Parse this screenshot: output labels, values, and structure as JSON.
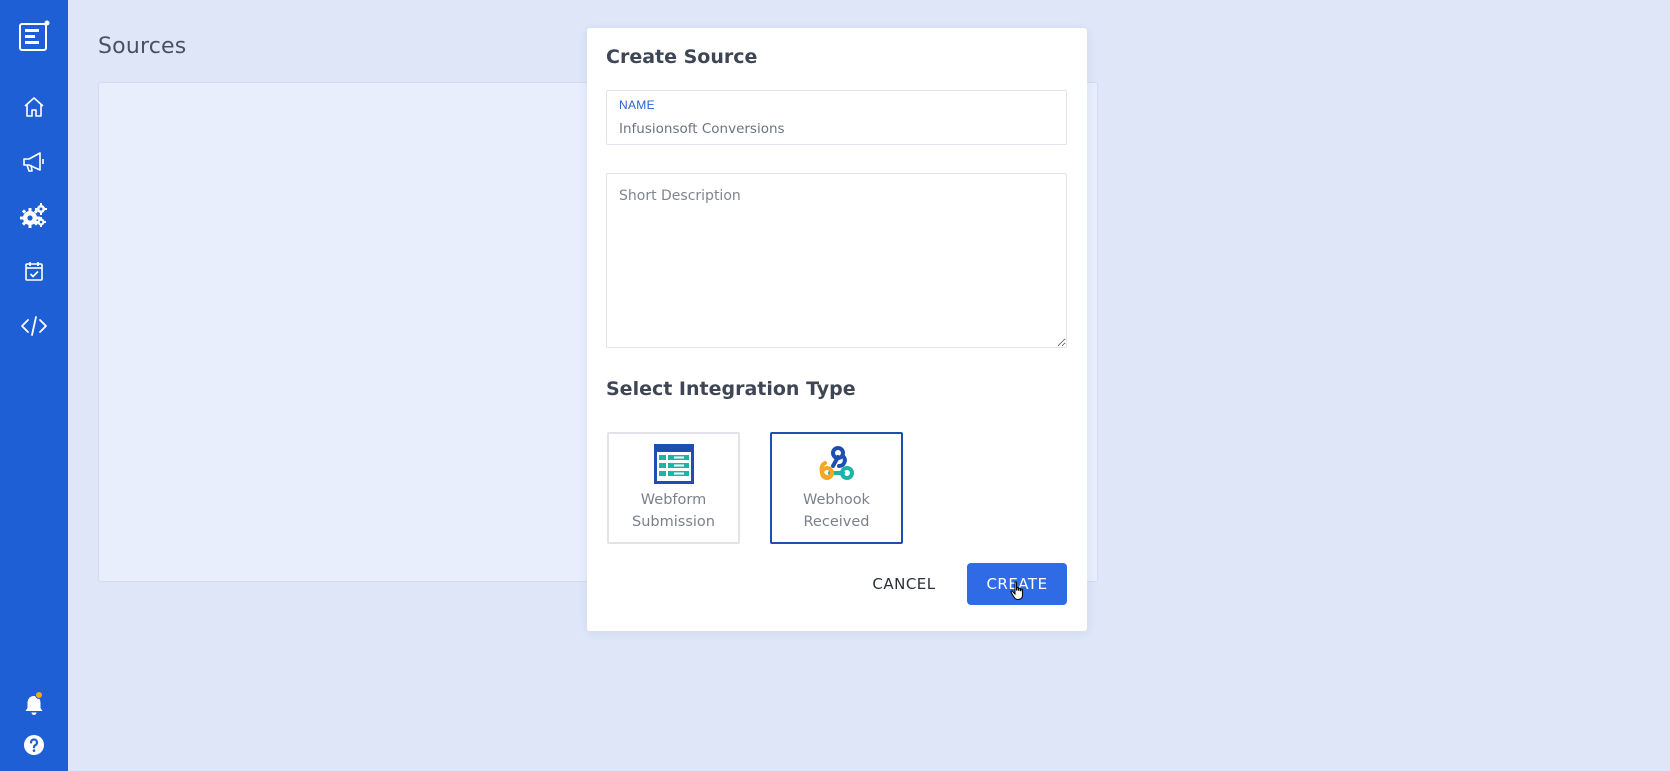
{
  "page": {
    "title": "Sources"
  },
  "sidebar": {
    "items": [
      {
        "name": "logo",
        "icon": "app-logo-icon"
      },
      {
        "name": "home",
        "icon": "home-icon"
      },
      {
        "name": "campaigns",
        "icon": "megaphone-icon"
      },
      {
        "name": "settings",
        "icon": "gears-icon"
      },
      {
        "name": "tasks",
        "icon": "calendar-check-icon"
      },
      {
        "name": "developer",
        "icon": "code-icon"
      },
      {
        "name": "notifications",
        "icon": "bell-icon"
      },
      {
        "name": "help",
        "icon": "help-icon"
      }
    ],
    "colors": {
      "background": "#1f5fd6",
      "badge": "#f5a623"
    }
  },
  "dialog": {
    "title": "Create Source",
    "name_field": {
      "label": "NAME",
      "value": "Infusionsoft Conversions"
    },
    "description_field": {
      "placeholder": "Short Description",
      "value": ""
    },
    "integration_section": {
      "title": "Select Integration Type",
      "options": [
        {
          "label": "Webform Submission",
          "icon": "webform-icon",
          "selected": false
        },
        {
          "label": "Webhook Received",
          "icon": "webhook-icon",
          "selected": true
        }
      ]
    },
    "buttons": {
      "cancel": "CANCEL",
      "create": "CREATE"
    },
    "colors": {
      "primary": "#2f6be5",
      "selected_border": "#1e4fb0"
    }
  }
}
